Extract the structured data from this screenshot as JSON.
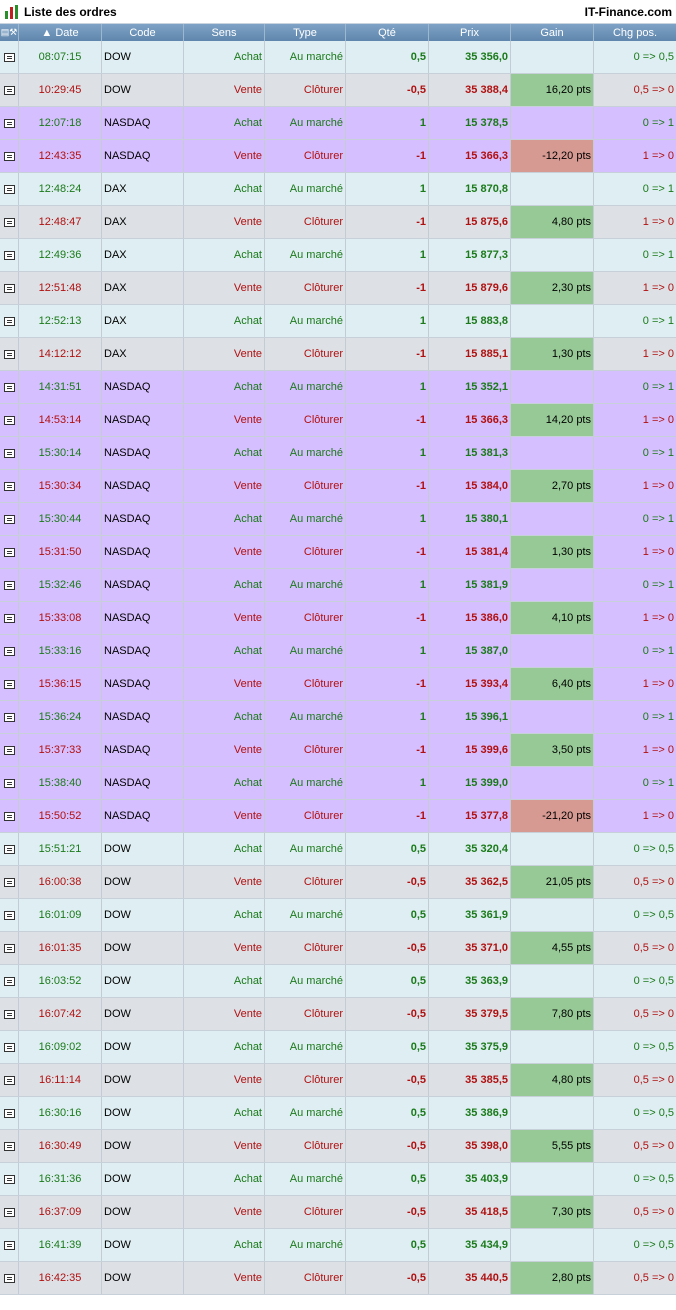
{
  "window": {
    "title": "Liste des ordres",
    "brand": "IT-Finance.com"
  },
  "columns": [
    "Date",
    "Code",
    "Sens",
    "Type",
    "Qté",
    "Prix",
    "Gain",
    "Chg pos."
  ],
  "colors": {
    "row_light": "#dfeef2",
    "row_gray": "#dde1e6",
    "row_purple": "#d6bfff",
    "up": "#1a7a1a",
    "down": "#b01010",
    "gain_pos": "#96c995",
    "gain_neg": "#d79a92"
  },
  "rows": [
    {
      "time": "08:07:15",
      "code": "DOW",
      "sens": "Achat",
      "type": "Au marché",
      "qty": "0,5",
      "price": "35 356,0",
      "gain": "",
      "chg": "0 => 0,5",
      "dir": "up",
      "bg": "light",
      "gain_kind": ""
    },
    {
      "time": "10:29:45",
      "code": "DOW",
      "sens": "Vente",
      "type": "Clôturer",
      "qty": "-0,5",
      "price": "35 388,4",
      "gain": "16,20 pts",
      "chg": "0,5 => 0",
      "dir": "down",
      "bg": "gray",
      "gain_kind": "pos"
    },
    {
      "time": "12:07:18",
      "code": "NASDAQ",
      "sens": "Achat",
      "type": "Au marché",
      "qty": "1",
      "price": "15 378,5",
      "gain": "",
      "chg": "0 => 1",
      "dir": "up",
      "bg": "purple",
      "gain_kind": ""
    },
    {
      "time": "12:43:35",
      "code": "NASDAQ",
      "sens": "Vente",
      "type": "Clôturer",
      "qty": "-1",
      "price": "15 366,3",
      "gain": "-12,20 pts",
      "chg": "1 => 0",
      "dir": "down",
      "bg": "purple",
      "gain_kind": "neg"
    },
    {
      "time": "12:48:24",
      "code": "DAX",
      "sens": "Achat",
      "type": "Au marché",
      "qty": "1",
      "price": "15 870,8",
      "gain": "",
      "chg": "0 => 1",
      "dir": "up",
      "bg": "light",
      "gain_kind": ""
    },
    {
      "time": "12:48:47",
      "code": "DAX",
      "sens": "Vente",
      "type": "Clôturer",
      "qty": "-1",
      "price": "15 875,6",
      "gain": "4,80 pts",
      "chg": "1 => 0",
      "dir": "down",
      "bg": "gray",
      "gain_kind": "pos"
    },
    {
      "time": "12:49:36",
      "code": "DAX",
      "sens": "Achat",
      "type": "Au marché",
      "qty": "1",
      "price": "15 877,3",
      "gain": "",
      "chg": "0 => 1",
      "dir": "up",
      "bg": "light",
      "gain_kind": ""
    },
    {
      "time": "12:51:48",
      "code": "DAX",
      "sens": "Vente",
      "type": "Clôturer",
      "qty": "-1",
      "price": "15 879,6",
      "gain": "2,30 pts",
      "chg": "1 => 0",
      "dir": "down",
      "bg": "gray",
      "gain_kind": "pos"
    },
    {
      "time": "12:52:13",
      "code": "DAX",
      "sens": "Achat",
      "type": "Au marché",
      "qty": "1",
      "price": "15 883,8",
      "gain": "",
      "chg": "0 => 1",
      "dir": "up",
      "bg": "light",
      "gain_kind": ""
    },
    {
      "time": "14:12:12",
      "code": "DAX",
      "sens": "Vente",
      "type": "Clôturer",
      "qty": "-1",
      "price": "15 885,1",
      "gain": "1,30 pts",
      "chg": "1 => 0",
      "dir": "down",
      "bg": "gray",
      "gain_kind": "pos"
    },
    {
      "time": "14:31:51",
      "code": "NASDAQ",
      "sens": "Achat",
      "type": "Au marché",
      "qty": "1",
      "price": "15 352,1",
      "gain": "",
      "chg": "0 => 1",
      "dir": "up",
      "bg": "purple",
      "gain_kind": ""
    },
    {
      "time": "14:53:14",
      "code": "NASDAQ",
      "sens": "Vente",
      "type": "Clôturer",
      "qty": "-1",
      "price": "15 366,3",
      "gain": "14,20 pts",
      "chg": "1 => 0",
      "dir": "down",
      "bg": "purple",
      "gain_kind": "pos"
    },
    {
      "time": "15:30:14",
      "code": "NASDAQ",
      "sens": "Achat",
      "type": "Au marché",
      "qty": "1",
      "price": "15 381,3",
      "gain": "",
      "chg": "0 => 1",
      "dir": "up",
      "bg": "purple",
      "gain_kind": ""
    },
    {
      "time": "15:30:34",
      "code": "NASDAQ",
      "sens": "Vente",
      "type": "Clôturer",
      "qty": "-1",
      "price": "15 384,0",
      "gain": "2,70 pts",
      "chg": "1 => 0",
      "dir": "down",
      "bg": "purple",
      "gain_kind": "pos"
    },
    {
      "time": "15:30:44",
      "code": "NASDAQ",
      "sens": "Achat",
      "type": "Au marché",
      "qty": "1",
      "price": "15 380,1",
      "gain": "",
      "chg": "0 => 1",
      "dir": "up",
      "bg": "purple",
      "gain_kind": ""
    },
    {
      "time": "15:31:50",
      "code": "NASDAQ",
      "sens": "Vente",
      "type": "Clôturer",
      "qty": "-1",
      "price": "15 381,4",
      "gain": "1,30 pts",
      "chg": "1 => 0",
      "dir": "down",
      "bg": "purple",
      "gain_kind": "pos"
    },
    {
      "time": "15:32:46",
      "code": "NASDAQ",
      "sens": "Achat",
      "type": "Au marché",
      "qty": "1",
      "price": "15 381,9",
      "gain": "",
      "chg": "0 => 1",
      "dir": "up",
      "bg": "purple",
      "gain_kind": ""
    },
    {
      "time": "15:33:08",
      "code": "NASDAQ",
      "sens": "Vente",
      "type": "Clôturer",
      "qty": "-1",
      "price": "15 386,0",
      "gain": "4,10 pts",
      "chg": "1 => 0",
      "dir": "down",
      "bg": "purple",
      "gain_kind": "pos"
    },
    {
      "time": "15:33:16",
      "code": "NASDAQ",
      "sens": "Achat",
      "type": "Au marché",
      "qty": "1",
      "price": "15 387,0",
      "gain": "",
      "chg": "0 => 1",
      "dir": "up",
      "bg": "purple",
      "gain_kind": ""
    },
    {
      "time": "15:36:15",
      "code": "NASDAQ",
      "sens": "Vente",
      "type": "Clôturer",
      "qty": "-1",
      "price": "15 393,4",
      "gain": "6,40 pts",
      "chg": "1 => 0",
      "dir": "down",
      "bg": "purple",
      "gain_kind": "pos"
    },
    {
      "time": "15:36:24",
      "code": "NASDAQ",
      "sens": "Achat",
      "type": "Au marché",
      "qty": "1",
      "price": "15 396,1",
      "gain": "",
      "chg": "0 => 1",
      "dir": "up",
      "bg": "purple",
      "gain_kind": ""
    },
    {
      "time": "15:37:33",
      "code": "NASDAQ",
      "sens": "Vente",
      "type": "Clôturer",
      "qty": "-1",
      "price": "15 399,6",
      "gain": "3,50 pts",
      "chg": "1 => 0",
      "dir": "down",
      "bg": "purple",
      "gain_kind": "pos"
    },
    {
      "time": "15:38:40",
      "code": "NASDAQ",
      "sens": "Achat",
      "type": "Au marché",
      "qty": "1",
      "price": "15 399,0",
      "gain": "",
      "chg": "0 => 1",
      "dir": "up",
      "bg": "purple",
      "gain_kind": ""
    },
    {
      "time": "15:50:52",
      "code": "NASDAQ",
      "sens": "Vente",
      "type": "Clôturer",
      "qty": "-1",
      "price": "15 377,8",
      "gain": "-21,20 pts",
      "chg": "1 => 0",
      "dir": "down",
      "bg": "purple",
      "gain_kind": "neg"
    },
    {
      "time": "15:51:21",
      "code": "DOW",
      "sens": "Achat",
      "type": "Au marché",
      "qty": "0,5",
      "price": "35 320,4",
      "gain": "",
      "chg": "0 => 0,5",
      "dir": "up",
      "bg": "light",
      "gain_kind": ""
    },
    {
      "time": "16:00:38",
      "code": "DOW",
      "sens": "Vente",
      "type": "Clôturer",
      "qty": "-0,5",
      "price": "35 362,5",
      "gain": "21,05 pts",
      "chg": "0,5 => 0",
      "dir": "down",
      "bg": "gray",
      "gain_kind": "pos"
    },
    {
      "time": "16:01:09",
      "code": "DOW",
      "sens": "Achat",
      "type": "Au marché",
      "qty": "0,5",
      "price": "35 361,9",
      "gain": "",
      "chg": "0 => 0,5",
      "dir": "up",
      "bg": "light",
      "gain_kind": ""
    },
    {
      "time": "16:01:35",
      "code": "DOW",
      "sens": "Vente",
      "type": "Clôturer",
      "qty": "-0,5",
      "price": "35 371,0",
      "gain": "4,55 pts",
      "chg": "0,5 => 0",
      "dir": "down",
      "bg": "gray",
      "gain_kind": "pos"
    },
    {
      "time": "16:03:52",
      "code": "DOW",
      "sens": "Achat",
      "type": "Au marché",
      "qty": "0,5",
      "price": "35 363,9",
      "gain": "",
      "chg": "0 => 0,5",
      "dir": "up",
      "bg": "light",
      "gain_kind": ""
    },
    {
      "time": "16:07:42",
      "code": "DOW",
      "sens": "Vente",
      "type": "Clôturer",
      "qty": "-0,5",
      "price": "35 379,5",
      "gain": "7,80 pts",
      "chg": "0,5 => 0",
      "dir": "down",
      "bg": "gray",
      "gain_kind": "pos"
    },
    {
      "time": "16:09:02",
      "code": "DOW",
      "sens": "Achat",
      "type": "Au marché",
      "qty": "0,5",
      "price": "35 375,9",
      "gain": "",
      "chg": "0 => 0,5",
      "dir": "up",
      "bg": "light",
      "gain_kind": ""
    },
    {
      "time": "16:11:14",
      "code": "DOW",
      "sens": "Vente",
      "type": "Clôturer",
      "qty": "-0,5",
      "price": "35 385,5",
      "gain": "4,80 pts",
      "chg": "0,5 => 0",
      "dir": "down",
      "bg": "gray",
      "gain_kind": "pos"
    },
    {
      "time": "16:30:16",
      "code": "DOW",
      "sens": "Achat",
      "type": "Au marché",
      "qty": "0,5",
      "price": "35 386,9",
      "gain": "",
      "chg": "0 => 0,5",
      "dir": "up",
      "bg": "light",
      "gain_kind": ""
    },
    {
      "time": "16:30:49",
      "code": "DOW",
      "sens": "Vente",
      "type": "Clôturer",
      "qty": "-0,5",
      "price": "35 398,0",
      "gain": "5,55 pts",
      "chg": "0,5 => 0",
      "dir": "down",
      "bg": "gray",
      "gain_kind": "pos"
    },
    {
      "time": "16:31:36",
      "code": "DOW",
      "sens": "Achat",
      "type": "Au marché",
      "qty": "0,5",
      "price": "35 403,9",
      "gain": "",
      "chg": "0 => 0,5",
      "dir": "up",
      "bg": "light",
      "gain_kind": ""
    },
    {
      "time": "16:37:09",
      "code": "DOW",
      "sens": "Vente",
      "type": "Clôturer",
      "qty": "-0,5",
      "price": "35 418,5",
      "gain": "7,30 pts",
      "chg": "0,5 => 0",
      "dir": "down",
      "bg": "gray",
      "gain_kind": "pos"
    },
    {
      "time": "16:41:39",
      "code": "DOW",
      "sens": "Achat",
      "type": "Au marché",
      "qty": "0,5",
      "price": "35 434,9",
      "gain": "",
      "chg": "0 => 0,5",
      "dir": "up",
      "bg": "light",
      "gain_kind": ""
    },
    {
      "time": "16:42:35",
      "code": "DOW",
      "sens": "Vente",
      "type": "Clôturer",
      "qty": "-0,5",
      "price": "35 440,5",
      "gain": "2,80 pts",
      "chg": "0,5 => 0",
      "dir": "down",
      "bg": "gray",
      "gain_kind": "pos"
    }
  ]
}
